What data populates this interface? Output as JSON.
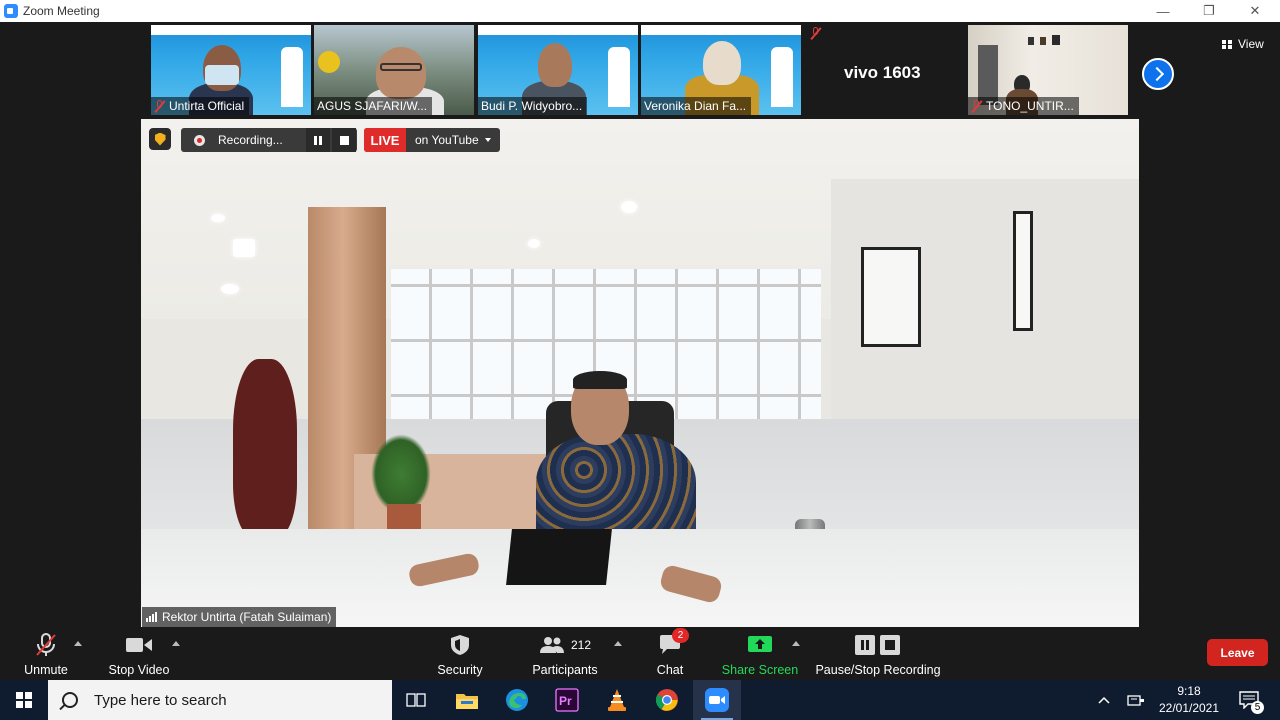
{
  "window": {
    "title": "Zoom Meeting",
    "controls": [
      "—",
      "❐",
      "✕"
    ]
  },
  "gallery": {
    "participants": [
      {
        "name": "Untirta Official",
        "muted": true
      },
      {
        "name": "AGUS SJAFARI/W...",
        "muted": false
      },
      {
        "name": "Budi P. Widyobro...",
        "muted": false
      },
      {
        "name": "Veronika Dian Fa...",
        "muted": false
      },
      {
        "name": "",
        "muted": true
      },
      {
        "name": "TONO_UNTIR...",
        "muted": true
      }
    ],
    "text_tile_name": "vivo 1603",
    "view_label": "View"
  },
  "recording": {
    "status": "Recording...",
    "live_label": "LIVE",
    "stream_target": "on YouTube"
  },
  "active_speaker": {
    "name": "Rektor Untirta (Fatah Sulaiman)"
  },
  "toolbar": {
    "unmute": "Unmute",
    "stop_video": "Stop Video",
    "security": "Security",
    "participants_label": "Participants",
    "participants_count": "212",
    "chat": "Chat",
    "chat_badge": "2",
    "share_screen": "Share Screen",
    "pause_stop_recording": "Pause/Stop Recording",
    "leave": "Leave"
  },
  "taskbar": {
    "search_placeholder": "Type here to search",
    "apps": [
      "task-view",
      "file-explorer",
      "edge",
      "premiere-pro",
      "vlc",
      "chrome",
      "zoom"
    ],
    "time": "9:18",
    "date": "22/01/2021",
    "notification_count": "5"
  },
  "colors": {
    "zoom_blue": "#2D8CFF",
    "leave_red": "#d3251f",
    "live_red": "#e02b2b",
    "share_green": "#23d959",
    "taskbar": "#0f1b2e"
  }
}
